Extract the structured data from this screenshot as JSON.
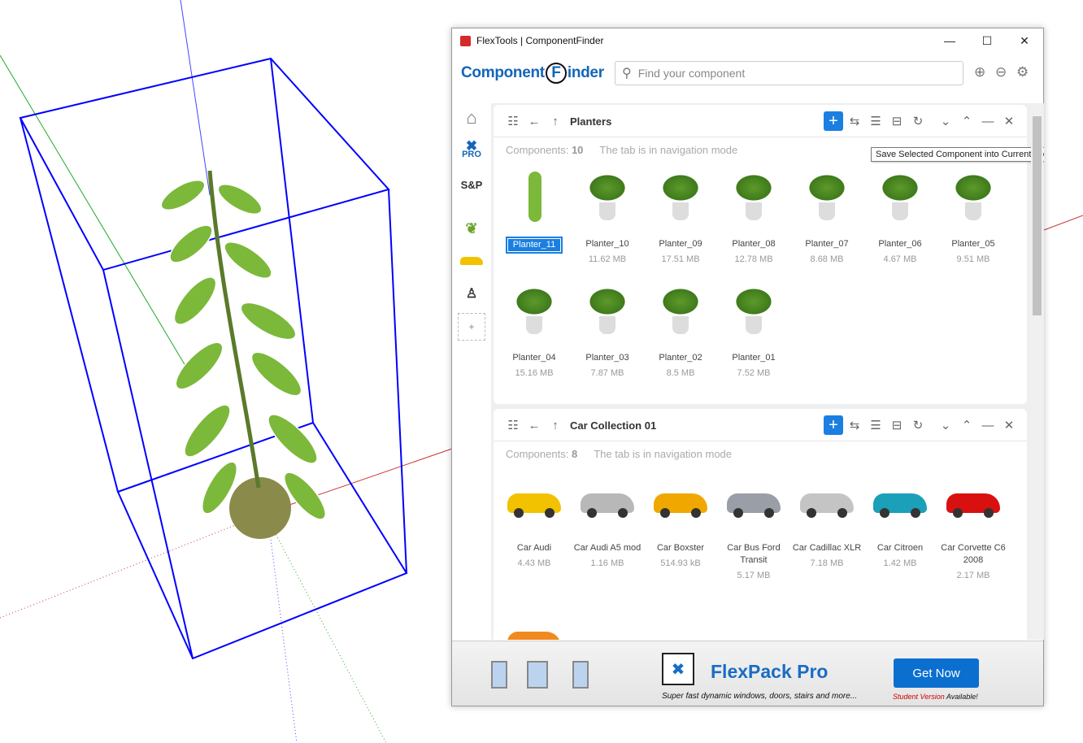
{
  "window": {
    "title": "FlexTools | ComponentFinder",
    "minimize": "—",
    "maximize": "☐",
    "close": "✕"
  },
  "header": {
    "logo": "ComponentFinder",
    "logo_part1": "Component",
    "logo_f": "F",
    "logo_part2": "inder",
    "search_placeholder": "Find your component"
  },
  "sidebar": {
    "items": [
      {
        "name": "home"
      },
      {
        "name": "flexpack-pro",
        "label": "PRO"
      },
      {
        "name": "s-and-p",
        "label": "S&P"
      },
      {
        "name": "planters"
      },
      {
        "name": "cars"
      },
      {
        "name": "people"
      },
      {
        "name": "add",
        "label": "+"
      }
    ]
  },
  "panels": [
    {
      "title": "Planters",
      "components_label": "Components:",
      "count": "10",
      "mode": "The tab is in navigation mode",
      "tooltip": "Save Selected Component into Current Folder",
      "items": [
        {
          "name": "Planter_11",
          "size": "",
          "selected": true
        },
        {
          "name": "Planter_10",
          "size": "11.62 MB"
        },
        {
          "name": "Planter_09",
          "size": "17.51 MB"
        },
        {
          "name": "Planter_08",
          "size": "12.78 MB"
        },
        {
          "name": "Planter_07",
          "size": "8.68 MB"
        },
        {
          "name": "Planter_06",
          "size": "4.67 MB"
        },
        {
          "name": "Planter_05",
          "size": "9.51 MB"
        },
        {
          "name": "Planter_04",
          "size": "15.16 MB"
        },
        {
          "name": "Planter_03",
          "size": "7.87 MB"
        },
        {
          "name": "Planter_02",
          "size": "8.5 MB"
        },
        {
          "name": "Planter_01",
          "size": "7.52 MB"
        }
      ]
    },
    {
      "title": "Car Collection 01",
      "components_label": "Components:",
      "count": "8",
      "mode": "The tab is in navigation mode",
      "items": [
        {
          "name": "Car Audi",
          "size": "4.43 MB",
          "color": "#f2c200"
        },
        {
          "name": "Car Audi A5 mod",
          "size": "1.16 MB",
          "color": "#b8b8b8"
        },
        {
          "name": "Car Boxster",
          "size": "514.93 kB",
          "color": "#f0a800"
        },
        {
          "name": "Car Bus Ford Transit",
          "size": "5.17 MB",
          "color": "#9a9ea6"
        },
        {
          "name": "Car Cadillac XLR",
          "size": "7.18 MB",
          "color": "#c4c4c4"
        },
        {
          "name": "Car Citroen",
          "size": "1.42 MB",
          "color": "#1aa0b8"
        },
        {
          "name": "Car Corvette C6 2008",
          "size": "2.17 MB",
          "color": "#d81010"
        },
        {
          "name": "",
          "size": "",
          "color": "#f08a20"
        }
      ]
    }
  ],
  "ad": {
    "title": "FlexPack Pro",
    "subtitle": "Super fast dynamic windows, doors, stairs and more...",
    "button": "Get Now",
    "student": "Student Version",
    "available": "Available!"
  },
  "colors": {
    "accent": "#1a7fe0",
    "bbox": "#0000ff",
    "leaf": "#6aa52a"
  }
}
